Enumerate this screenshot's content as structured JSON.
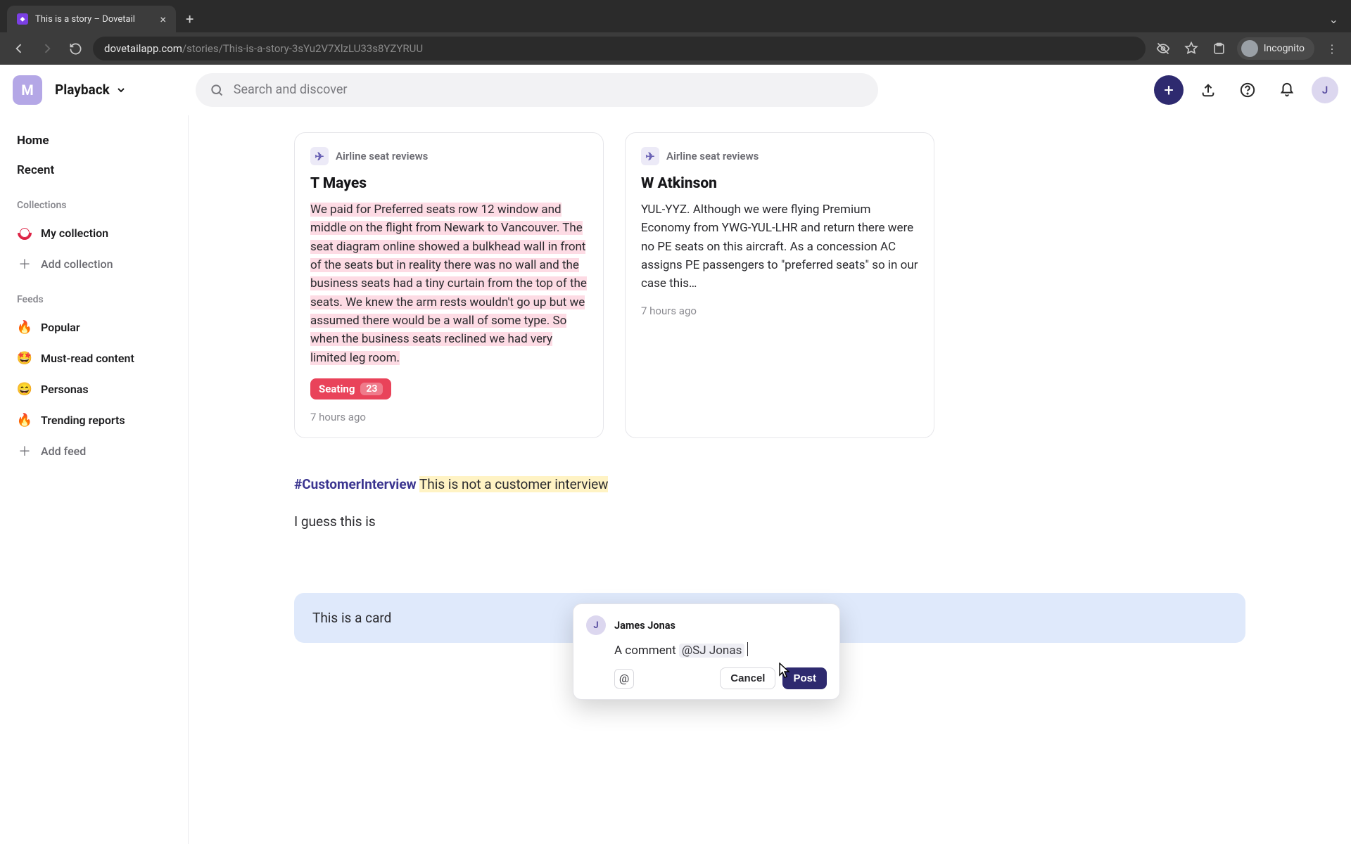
{
  "browser": {
    "tab_title": "This is a story – Dovetail",
    "url_host": "dovetailapp.com",
    "url_path": "/stories/This-is-a-story-3sYu2V7XlzLU33s8YZYRUU",
    "incognito_label": "Incognito"
  },
  "header": {
    "workspace_initial": "M",
    "playback_label": "Playback",
    "search_placeholder": "Search and discover",
    "user_initial": "J"
  },
  "sidebar": {
    "home": "Home",
    "recent": "Recent",
    "collections_label": "Collections",
    "my_collection": "My collection",
    "add_collection": "Add collection",
    "feeds_label": "Feeds",
    "feeds": [
      {
        "icon": "🔥",
        "label": "Popular"
      },
      {
        "icon": "🤩",
        "label": "Must-read content"
      },
      {
        "icon": "😄",
        "label": "Personas"
      },
      {
        "icon": "🔥",
        "label": "Trending reports"
      }
    ],
    "add_feed": "Add feed"
  },
  "cards": [
    {
      "source": "Airline seat reviews",
      "title": "T Mayes",
      "body": "We paid for Preferred seats row 12 window and middle on the flight from Newark to Vancouver. The seat diagram online showed a bulkhead wall in front of the seats but in reality there was no wall and the business seats had a tiny curtain from the top of the seats. We knew the arm rests wouldn't go up but we assumed there would be a wall of some type. So when the business seats reclined we had very limited leg room.",
      "highlighted": true,
      "tag": {
        "label": "Seating",
        "count": "23"
      },
      "time": "7 hours ago"
    },
    {
      "source": "Airline seat reviews",
      "title": "W Atkinson",
      "body": "YUL-YYZ. Although we were flying Premium Economy from YWG-YUL-LHR and return there were no PE seats on this aircraft. As a concession AC assigns PE passengers to \"preferred seats\" so in our case this…",
      "highlighted": false,
      "time": "7 hours ago"
    }
  ],
  "story": {
    "hashtag": "#CustomerInterview",
    "line1_rest": "This is not a customer interview",
    "line2": "I guess this is",
    "card_text": "This is a card"
  },
  "comment": {
    "author_initial": "J",
    "author_name": "James Jonas",
    "text_prefix": "A comment ",
    "mention": "@SJ Jonas",
    "cancel": "Cancel",
    "post": "Post"
  }
}
